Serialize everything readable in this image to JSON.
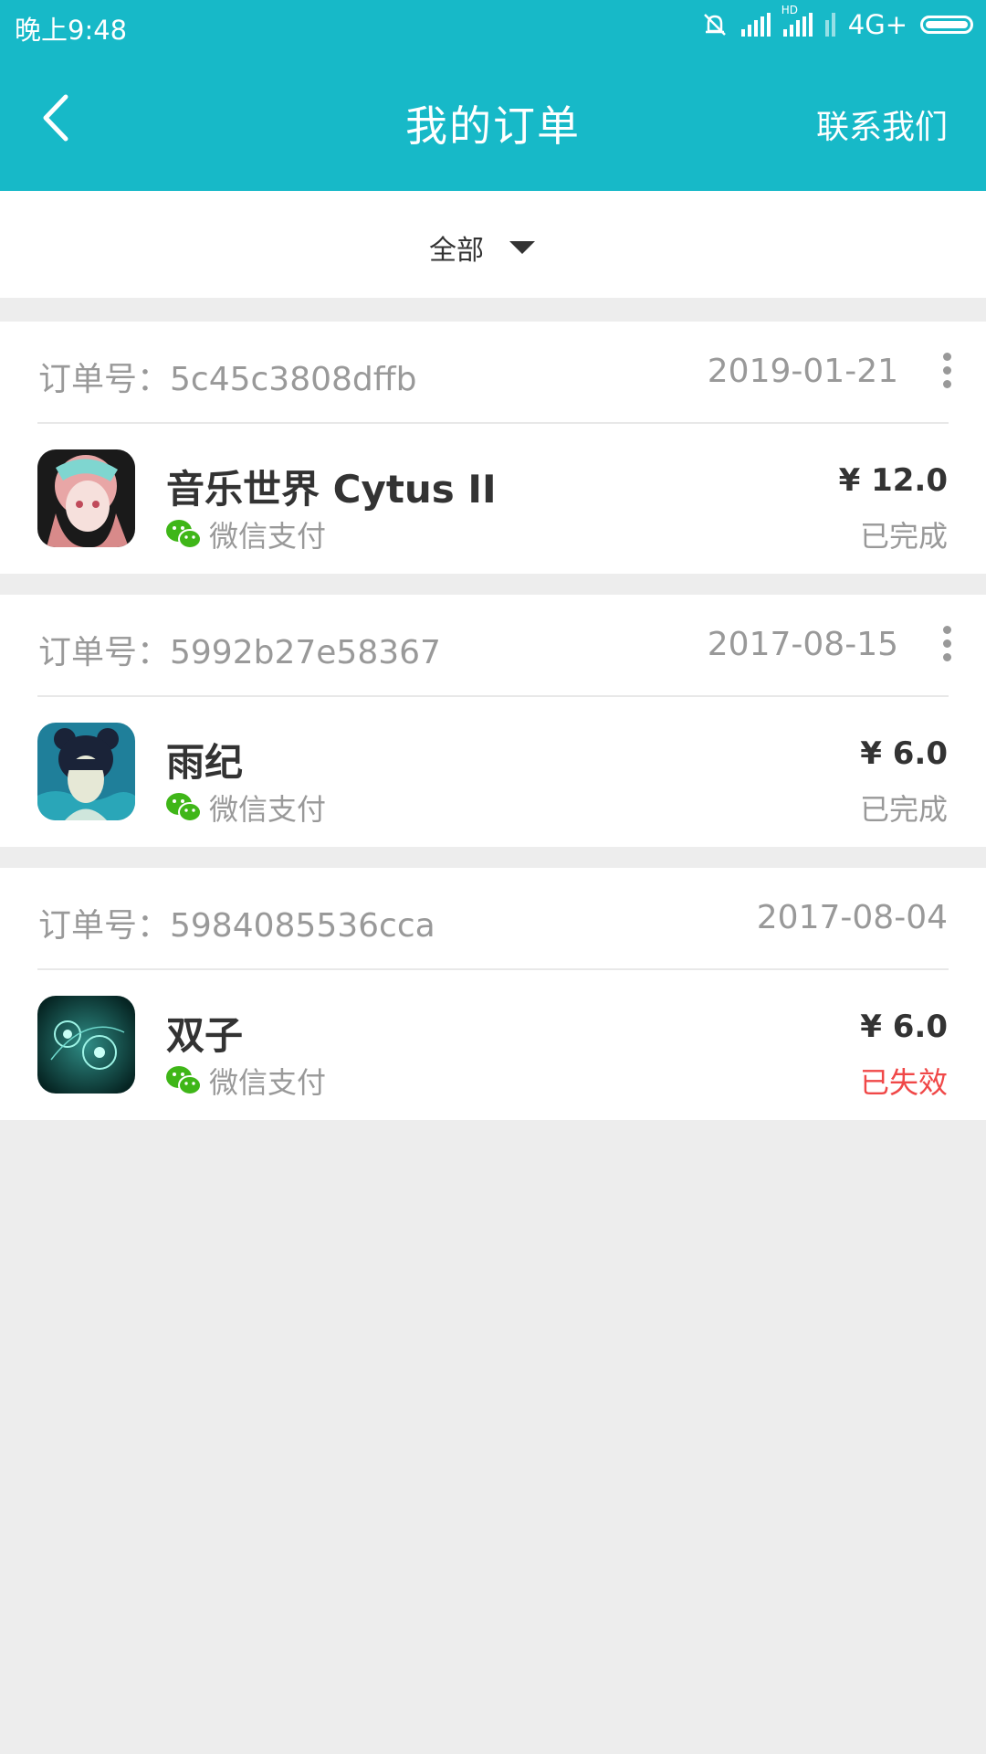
{
  "status_bar": {
    "time": "晚上9:48",
    "network": "4G+"
  },
  "header": {
    "title": "我的订单",
    "contact": "联系我们"
  },
  "filter": {
    "selected": "全部"
  },
  "orders": [
    {
      "order_no": "订单号：5c45c3808dffb",
      "date": "2019-01-21",
      "name": "音乐世界 Cytus II",
      "pay_method": "微信支付",
      "price": "¥ 12.0",
      "status": "已完成"
    },
    {
      "order_no": "订单号：5992b27e58367",
      "date": "2017-08-15",
      "name": "雨纪",
      "pay_method": "微信支付",
      "price": "¥ 6.0",
      "status": "已完成"
    },
    {
      "order_no": "订单号：5984085536cca",
      "date": "2017-08-04",
      "name": "双子",
      "pay_method": "微信支付",
      "price": "¥ 6.0",
      "status": "已失效"
    }
  ],
  "colors": {
    "header_bg": "#17b9c8",
    "page_bg": "#ededed",
    "wechat_green": "#3fb618",
    "invalid_red": "#f04848"
  },
  "icons": {
    "back": "chevron-left-icon",
    "more": "more-vertical-icon",
    "pay": "wechat-icon",
    "filter": "caret-down-icon"
  }
}
